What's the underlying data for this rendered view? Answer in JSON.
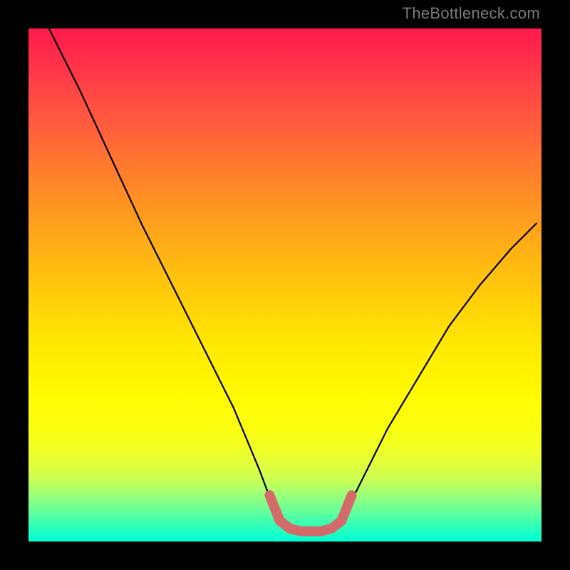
{
  "watermark": "TheBottleneck.com",
  "chart_data": {
    "type": "line",
    "title": "",
    "xlabel": "",
    "ylabel": "",
    "xlim": [
      0,
      100
    ],
    "ylim": [
      0,
      100
    ],
    "grid": false,
    "legend": false,
    "background_gradient": [
      "#ff1a4d",
      "#ff991f",
      "#fff100",
      "#00ffd5"
    ],
    "series": [
      {
        "name": "curve",
        "color": "#000000",
        "x": [
          4,
          10,
          16,
          22,
          28,
          34,
          40,
          45,
          48,
          50,
          52,
          54,
          56,
          58,
          60,
          62,
          65,
          70,
          76,
          82,
          88,
          94,
          99
        ],
        "y": [
          100,
          88,
          75,
          62,
          50,
          38,
          26,
          14,
          6,
          3,
          2,
          2,
          2,
          2,
          3,
          6,
          12,
          22,
          32,
          42,
          50,
          57,
          62
        ]
      },
      {
        "name": "highlight",
        "color": "#d46a6a",
        "stroke_width": 10,
        "x": [
          47,
          49,
          51,
          53,
          55,
          57,
          59,
          61,
          63
        ],
        "y": [
          9,
          4,
          2.5,
          2,
          2,
          2,
          2.5,
          4,
          9
        ]
      }
    ]
  }
}
